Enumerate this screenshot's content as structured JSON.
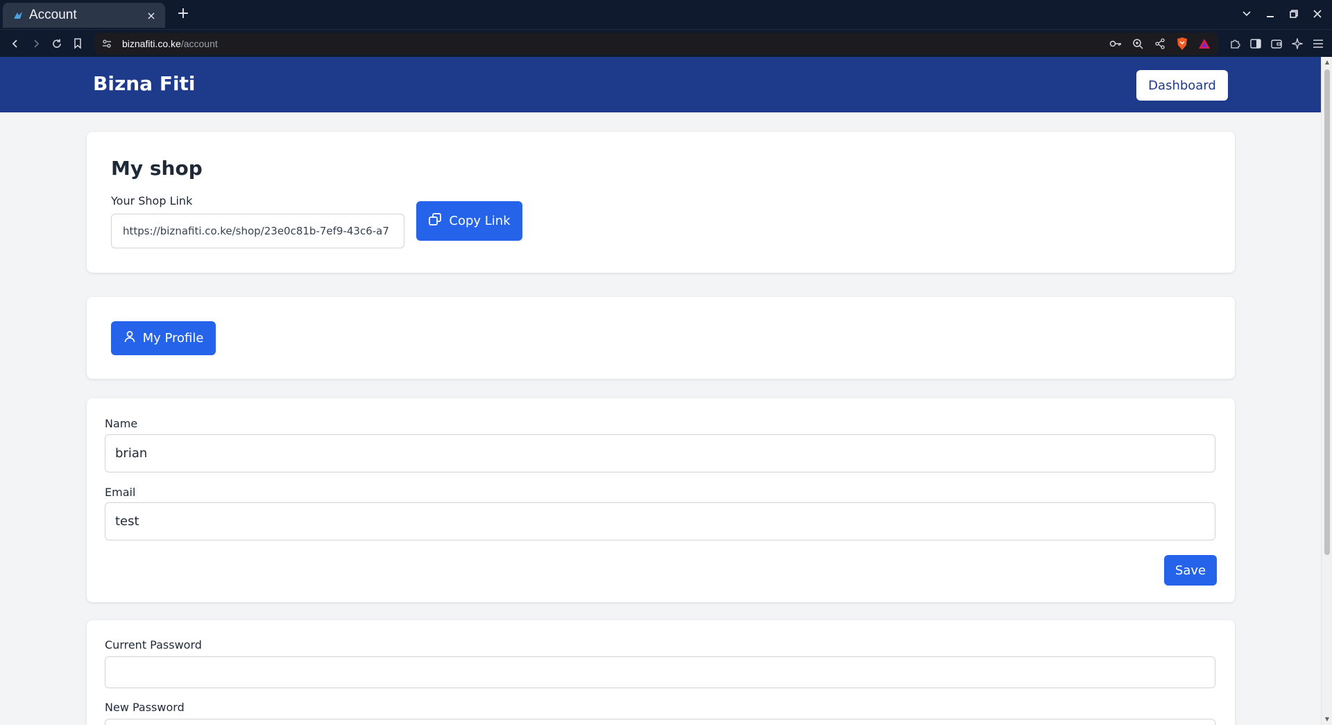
{
  "browser": {
    "tab_title": "Account",
    "tab_close": "×",
    "new_tab": "+",
    "url_domain": "biznafiti.co.ke",
    "url_path": "/account"
  },
  "header": {
    "brand": "Bizna Fiti",
    "dashboard_label": "Dashboard"
  },
  "shop": {
    "title": "My shop",
    "link_label": "Your Shop Link",
    "link_value": "https://biznafiti.co.ke/shop/23e0c81b-7ef9-43c6-a7",
    "copy_label": "Copy Link"
  },
  "profile": {
    "button_label": "My Profile",
    "name_label": "Name",
    "name_value": "brian",
    "email_label": "Email",
    "email_value": "test",
    "save_label": "Save"
  },
  "password": {
    "current_label": "Current Password",
    "current_value": "",
    "new_label": "New Password"
  },
  "colors": {
    "header_bg": "#1e3a8a",
    "primary": "#2563eb",
    "page_bg": "#f3f4f6"
  }
}
